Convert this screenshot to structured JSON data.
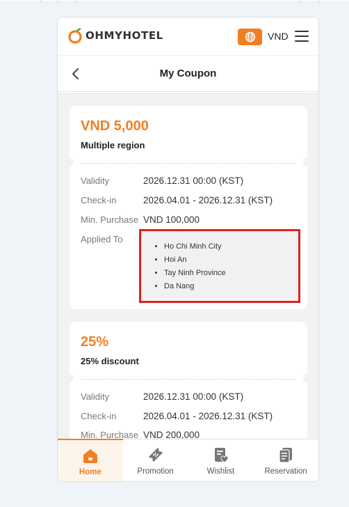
{
  "colors": {
    "accent": "#f07f22",
    "highlight_border": "#e01e1e",
    "card_bg": "#ffffff",
    "page_bg": "#f2f2f2"
  },
  "header": {
    "logo_text": "OHMYHOTEL",
    "language_icon": "globe-icon",
    "currency": "VND",
    "menu_icon": "hamburger-menu-icon"
  },
  "subheader": {
    "back_icon": "chevron-left-icon",
    "title": "My Coupon"
  },
  "coupons": [
    {
      "amount": "VND 5,000",
      "title": "Multiple region",
      "details": [
        {
          "label": "Validity",
          "value": "2026.12.31 00:00 (KST)"
        },
        {
          "label": "Check-in",
          "value": "2026.04.01 - 2026.12.31 (KST)"
        },
        {
          "label": "Min. Purchase",
          "value": "VND 100,000"
        }
      ],
      "applied_to_label": "Applied To",
      "applied_to": [
        "Ho Chi Minh City",
        "Hoi An",
        "Tay Ninh Province",
        "Da Nang"
      ]
    },
    {
      "amount": "25%",
      "title": "25% discount",
      "details": [
        {
          "label": "Validity",
          "value": "2026.12.31 00:00 (KST)"
        },
        {
          "label": "Check-in",
          "value": "2026.04.01 - 2026.12.31 (KST)"
        },
        {
          "label": "Min. Purchase",
          "value": "VND 200,000"
        }
      ]
    }
  ],
  "scroll_top_icon": "arrow-up-icon",
  "bottom_nav": [
    {
      "label": "Home",
      "icon": "home-icon",
      "active": true
    },
    {
      "label": "Promotion",
      "icon": "ticket-icon",
      "active": false
    },
    {
      "label": "Wishlist",
      "icon": "wishlist-icon",
      "active": false
    },
    {
      "label": "Reservation",
      "icon": "reservation-icon",
      "active": false
    }
  ]
}
